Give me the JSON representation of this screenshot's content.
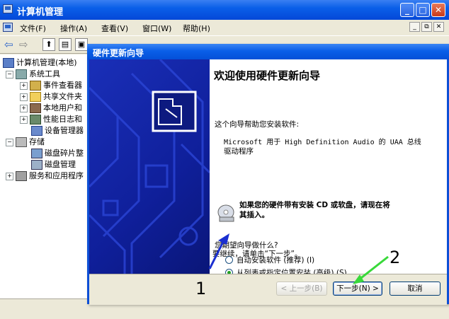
{
  "main_window": {
    "title": "计算机管理",
    "menus": [
      "文件(F)",
      "操作(A)",
      "查看(V)",
      "窗口(W)",
      "帮助(H)"
    ],
    "tree": [
      {
        "label": "计算机管理(本地)",
        "level": 0,
        "expander": ""
      },
      {
        "label": "系统工具",
        "level": 1,
        "expander": "−"
      },
      {
        "label": "事件查看器",
        "level": 2,
        "expander": "+"
      },
      {
        "label": "共享文件夹",
        "level": 2,
        "expander": "+"
      },
      {
        "label": "本地用户和",
        "level": 2,
        "expander": "+"
      },
      {
        "label": "性能日志和",
        "level": 2,
        "expander": "+"
      },
      {
        "label": "设备管理器",
        "level": 2,
        "expander": ""
      },
      {
        "label": "存储",
        "level": 1,
        "expander": "−"
      },
      {
        "label": "磁盘碎片整",
        "level": 2,
        "expander": ""
      },
      {
        "label": "磁盘管理",
        "level": 2,
        "expander": ""
      },
      {
        "label": "服务和应用程序",
        "level": 1,
        "expander": "+"
      }
    ]
  },
  "wizard": {
    "title": "硬件更新向导",
    "heading": "欢迎使用硬件更新向导",
    "intro": "这个向导帮助您安装软件:",
    "device_line1": "Microsoft 用于 High Definition Audio 的 UAA 总线",
    "device_line2": "驱动程序",
    "cd_hint_line1": "如果您的硬件带有安装 CD 或软盘，请现在将",
    "cd_hint_line2": "其插入。",
    "question": "您期望向导做什么?",
    "option_auto": "自动安装软件 (推荐) (I)",
    "option_list": "从列表或指定位置安装 (高级) (S)",
    "selected_option": "list",
    "continue_text": "要继续，请单击“下一步”。",
    "buttons": {
      "back": "< 上一步(B)",
      "next": "下一步(N) >",
      "cancel": "取消"
    }
  },
  "annotations": {
    "marker1": "1",
    "marker2": "2",
    "arrow1_color": "#1a2fd0",
    "arrow2_color": "#39d93a"
  }
}
